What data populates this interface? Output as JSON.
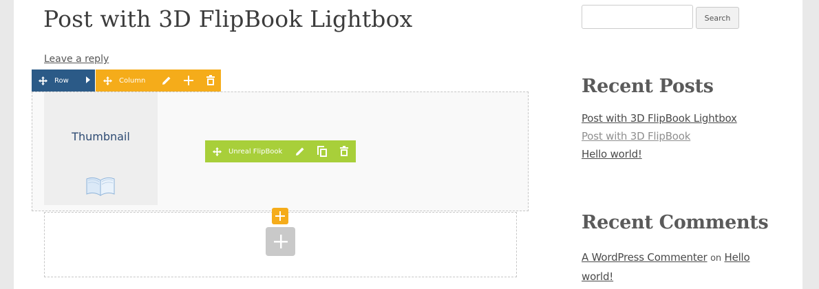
{
  "post": {
    "title": "Post with 3D FlipBook Lightbox",
    "leave_reply": "Leave a reply"
  },
  "builder": {
    "row_label": "Row",
    "column_label": "Column",
    "widget_label": "Unreal FlipBook",
    "thumbnail_label": "Thumbnail",
    "colors": {
      "row_bar": "#2b5a87",
      "column_bar": "#f5ac1a",
      "widget_bar": "#a8cf3a",
      "add_row": "#c9c9c9"
    },
    "icons": {
      "move": "move-arrows-icon",
      "edit": "pencil-icon",
      "add": "plus-icon",
      "delete": "trash-icon",
      "duplicate": "copy-icon",
      "expand": "chevron-right-icon",
      "thumbnail": "open-book-icon"
    }
  },
  "sidebar": {
    "search": {
      "value": "",
      "placeholder": "",
      "button_label": "Search"
    },
    "recent_posts": {
      "title": "Recent Posts",
      "items": [
        "Post with 3D FlipBook Lightbox",
        "Post with 3D FlipBook",
        "Hello world!"
      ]
    },
    "recent_comments": {
      "title": "Recent Comments",
      "author": "A WordPress Commenter",
      "on": "on",
      "post": "Hello world!"
    }
  }
}
